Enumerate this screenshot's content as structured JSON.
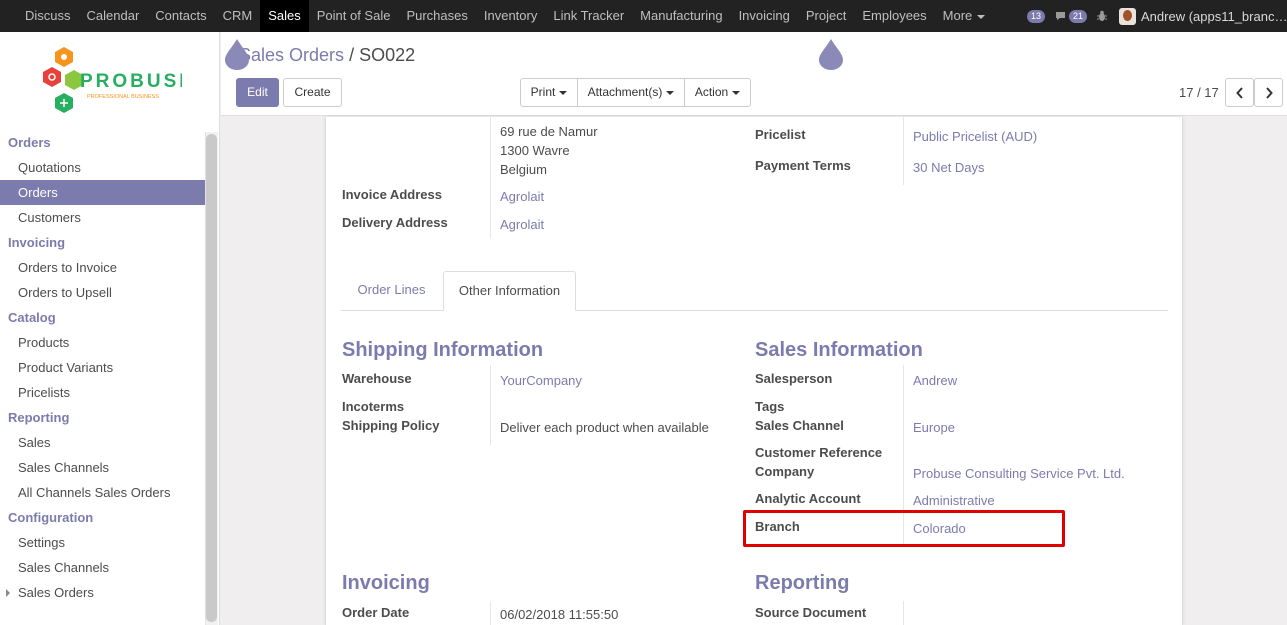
{
  "topbar": {
    "apps": [
      "Discuss",
      "Calendar",
      "Contacts",
      "CRM",
      "Sales",
      "Point of Sale",
      "Purchases",
      "Inventory",
      "Link Tracker",
      "Manufacturing",
      "Invoicing",
      "Project",
      "Employees"
    ],
    "active_app": "Sales",
    "more_label": "More",
    "activity_count": "13",
    "message_count": "21",
    "user_name": "Andrew (apps11_branc…"
  },
  "logo": {
    "name": "PROBUSE",
    "tagline": "PROFESSIONAL BUSINESS"
  },
  "sidebar": {
    "sections": [
      {
        "title": "Orders",
        "items": [
          "Quotations",
          "Orders",
          "Customers"
        ]
      },
      {
        "title": "Invoicing",
        "items": [
          "Orders to Invoice",
          "Orders to Upsell"
        ]
      },
      {
        "title": "Catalog",
        "items": [
          "Products",
          "Product Variants",
          "Pricelists"
        ]
      },
      {
        "title": "Reporting",
        "items": [
          "Sales",
          "Sales Channels",
          "All Channels Sales Orders"
        ]
      },
      {
        "title": "Configuration",
        "items": [
          "Settings",
          "Sales Channels",
          "Sales Orders"
        ]
      }
    ],
    "active_item": "Orders"
  },
  "control_panel": {
    "breadcrumb_parent": "Sales Orders",
    "breadcrumb_sep": "/",
    "breadcrumb_current": "SO022",
    "edit_label": "Edit",
    "create_label": "Create",
    "print_label": "Print",
    "attachments_label": "Attachment(s)",
    "action_label": "Action",
    "pager": "17 / 17"
  },
  "form": {
    "partner_address": [
      "69 rue de Namur",
      "1300 Wavre",
      "Belgium"
    ],
    "invoice_address_label": "Invoice Address",
    "invoice_address": "Agrolait",
    "delivery_address_label": "Delivery Address",
    "delivery_address": "Agrolait",
    "pricelist_label": "Pricelist",
    "pricelist": "Public Pricelist (AUD)",
    "payment_terms_label": "Payment Terms",
    "payment_terms": "30 Net Days",
    "tabs": [
      "Order Lines",
      "Other Information"
    ],
    "active_tab": "Other Information",
    "shipping": {
      "title": "Shipping Information",
      "warehouse_label": "Warehouse",
      "warehouse": "YourCompany",
      "incoterms_label": "Incoterms",
      "shipping_policy_label": "Shipping Policy",
      "shipping_policy": "Deliver each product when available"
    },
    "sales_info": {
      "title": "Sales Information",
      "salesperson_label": "Salesperson",
      "salesperson": "Andrew",
      "tags_label": "Tags",
      "sales_channel_label": "Sales Channel",
      "sales_channel": "Europe",
      "customer_ref_label": "Customer Reference",
      "company_label": "Company",
      "company": "Probuse Consulting Service Pvt. Ltd.",
      "analytic_label": "Analytic Account",
      "analytic": "Administrative",
      "branch_label": "Branch",
      "branch": "Colorado"
    },
    "invoicing": {
      "title": "Invoicing",
      "order_date_label": "Order Date",
      "order_date": "06/02/2018 11:55:50"
    },
    "reporting": {
      "title": "Reporting",
      "source_document_label": "Source Document"
    }
  },
  "colors": {
    "accent": "#7c7bad",
    "highlight": "#e00000",
    "topbar": "#222222"
  }
}
